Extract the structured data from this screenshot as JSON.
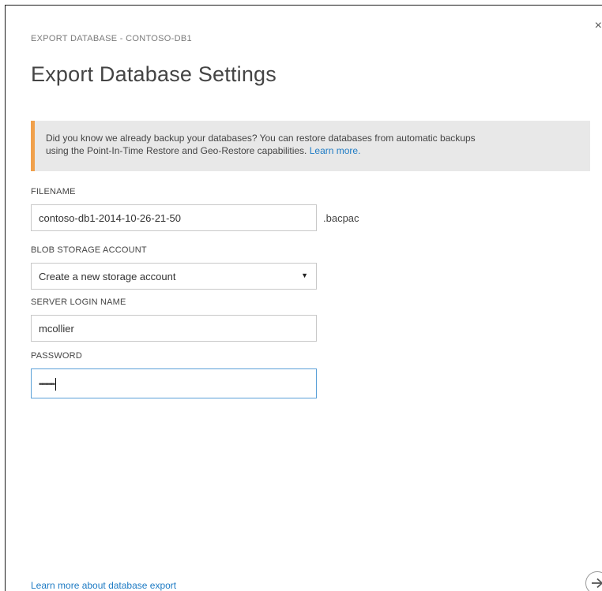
{
  "dialog": {
    "breadcrumb": "EXPORT DATABASE - CONTOSO-DB1",
    "title": "Export Database Settings",
    "close_glyph": "×"
  },
  "info": {
    "line1": "Did you know we already backup your databases? You can restore databases from automatic backups",
    "line2": "using the Point-In-Time Restore and Geo-Restore capabilities.",
    "link": "Learn more.",
    "accent_color": "#f0a04b"
  },
  "form": {
    "filename": {
      "label": "FILENAME",
      "value": "contoso-db1-2014-10-26-21-50",
      "suffix": ".bacpac"
    },
    "blob_storage": {
      "label": "BLOB STORAGE ACCOUNT",
      "selected": "Create a new storage account"
    },
    "login": {
      "label": "SERVER LOGIN NAME",
      "value": "mcollier"
    },
    "password": {
      "label": "PASSWORD",
      "masked": "••••••••"
    }
  },
  "footer": {
    "link": "Learn more about database export",
    "next_icon": "arrow-right-icon"
  },
  "colors": {
    "link": "#1e7bc4",
    "focus_border": "#5aa0d8"
  }
}
